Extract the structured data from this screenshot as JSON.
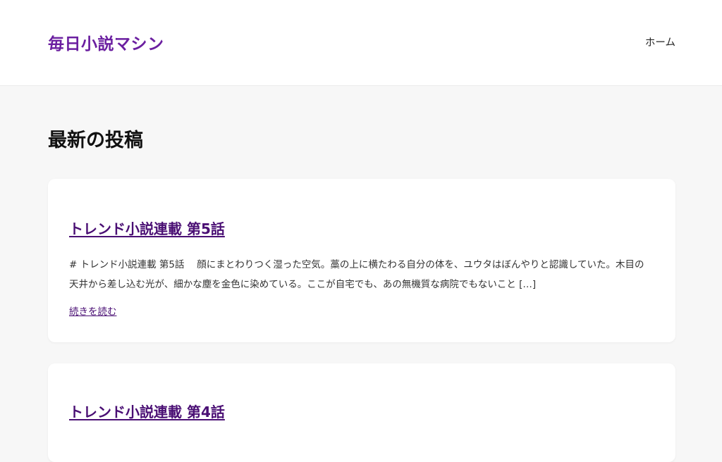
{
  "header": {
    "site_title": "毎日小説マシン",
    "nav": {
      "home_label": "ホーム"
    }
  },
  "main": {
    "heading": "最新の投稿",
    "posts": [
      {
        "title": "トレンド小説連載 第5話",
        "excerpt": "# トレンド小説連載 第5話　 顔にまとわりつく湿った空気。藁の上に横たわる自分の体を、ユウタはぼんやりと認識していた。木目の天井から差し込む光が、細かな塵を金色に染めている。ここが自宅でも、あの無機質な病院でもないこと […]",
        "read_more": "続きを読む"
      },
      {
        "title": "トレンド小説連載 第4話"
      }
    ]
  },
  "colors": {
    "brand": "#6b1fa0",
    "link": "#4a0f74",
    "background": "#f7f7f7",
    "card": "#ffffff"
  }
}
